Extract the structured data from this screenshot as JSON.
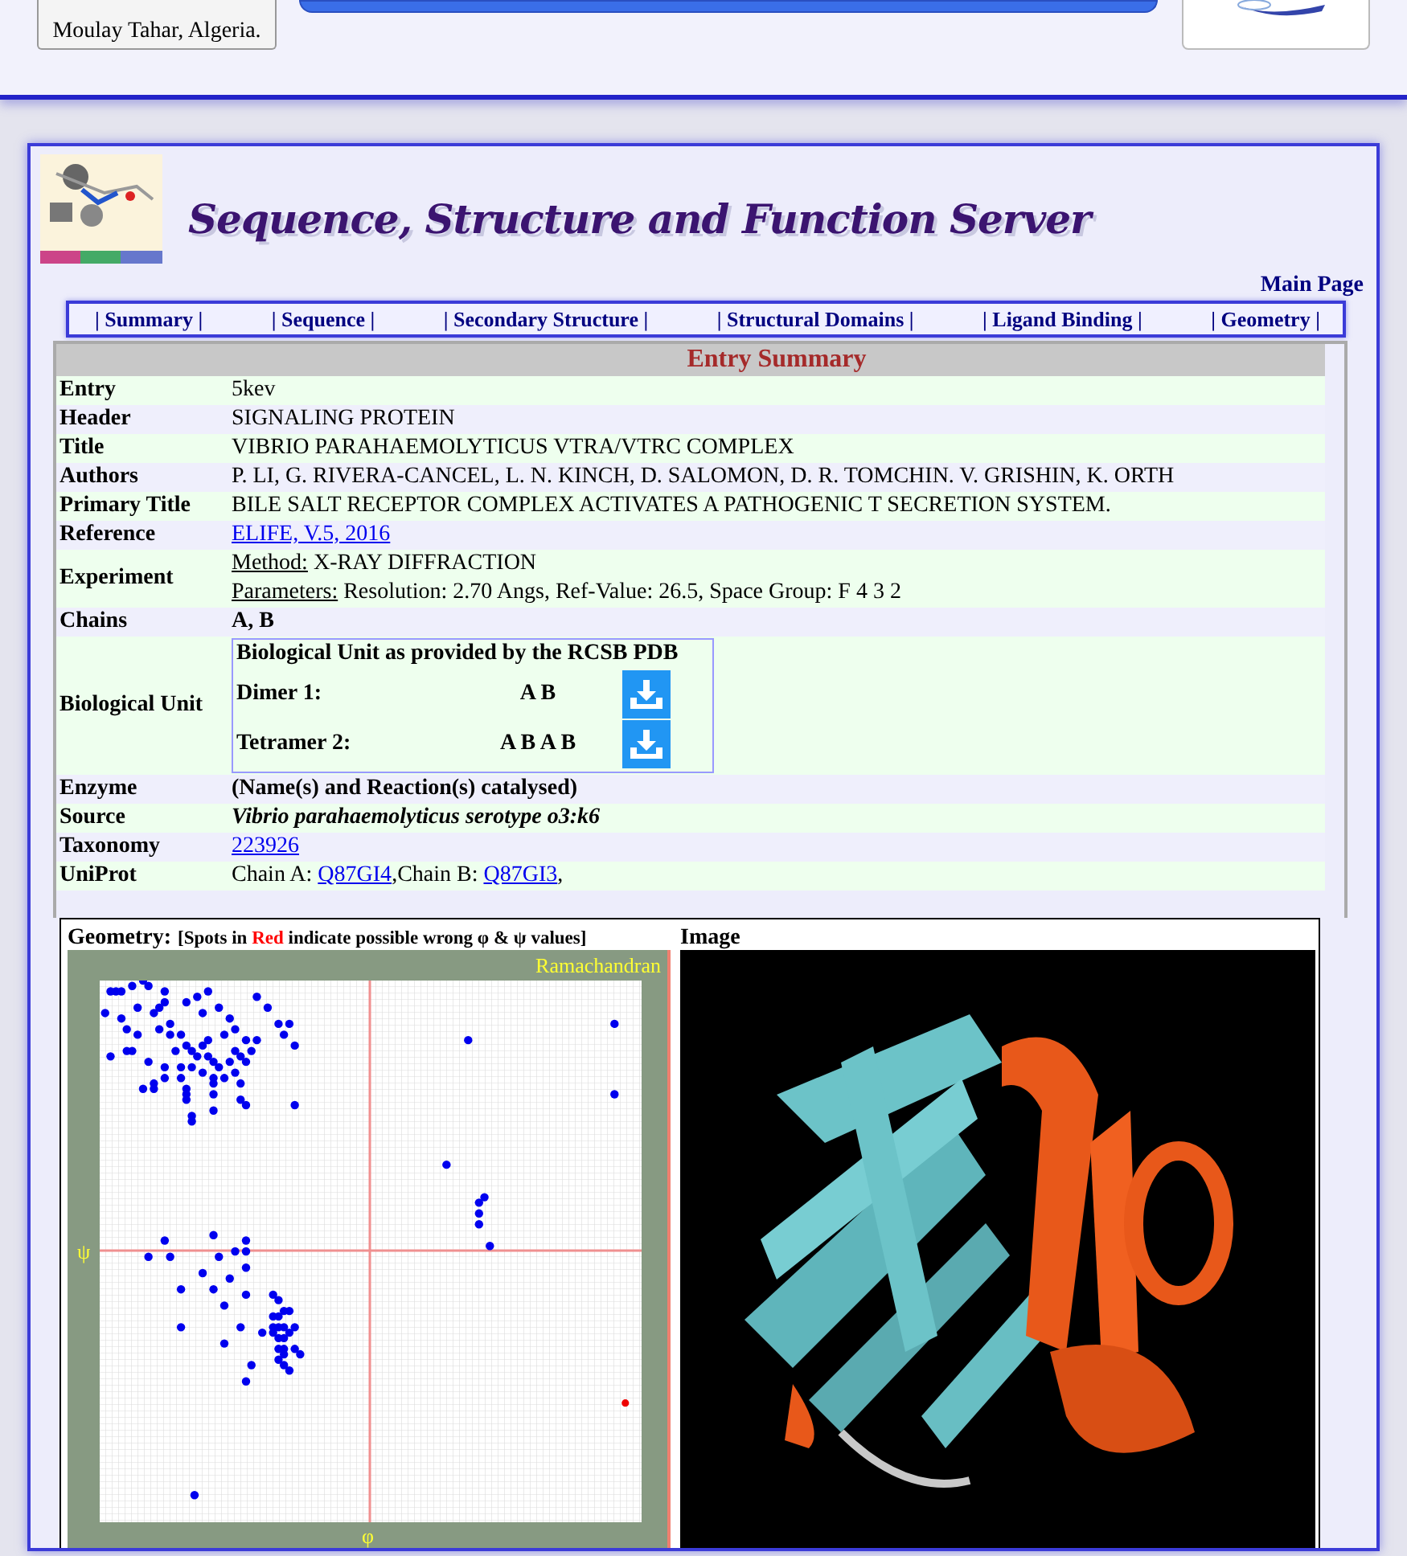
{
  "header": {
    "institution_line": "Moulay Tahar, Algeria."
  },
  "site_title": "Sequence, Structure and Function Server",
  "main_page_link": "Main Page",
  "nav": [
    {
      "label": "| Summary |"
    },
    {
      "label": "| Sequence |"
    },
    {
      "label": "| Secondary Structure |"
    },
    {
      "label": "| Structural Domains |"
    },
    {
      "label": "| Ligand Binding |"
    },
    {
      "label": "| Geometry |"
    }
  ],
  "summary": {
    "title": "Entry Summary",
    "rows": [
      {
        "label": "Entry",
        "kind": "plain",
        "lines": [
          [
            {
              "kind": "text",
              "text": "5kev"
            }
          ]
        ]
      },
      {
        "label": "Header",
        "kind": "plain",
        "lines": [
          [
            {
              "kind": "text",
              "text": "SIGNALING PROTEIN"
            }
          ]
        ]
      },
      {
        "label": "Title",
        "kind": "plain",
        "lines": [
          [
            {
              "kind": "text",
              "text": "VIBRIO PARAHAEMOLYTICUS VTRA/VTRC COMPLEX"
            }
          ]
        ]
      },
      {
        "label": "Authors",
        "kind": "plain",
        "lines": [
          [
            {
              "kind": "text",
              "text": "P. LI, G. RIVERA-CANCEL, L. N. KINCH, D. SALOMON, D. R. TOMCHIN. V. GRISHIN, K. ORTH"
            }
          ]
        ]
      },
      {
        "label": "Primary Title",
        "kind": "plain",
        "lines": [
          [
            {
              "kind": "text",
              "text": "BILE SALT RECEPTOR COMPLEX ACTIVATES A PATHOGENIC T SECRETION SYSTEM."
            }
          ]
        ]
      },
      {
        "label": "Reference",
        "kind": "plain",
        "lines": [
          [
            {
              "kind": "link",
              "text": "ELIFE, V.5, 2016"
            }
          ]
        ]
      },
      {
        "label": "Experiment",
        "kind": "plain",
        "lines": [
          [
            {
              "kind": "underlined",
              "text": "Method:"
            },
            {
              "kind": "text",
              "text": " X-RAY DIFFRACTION"
            }
          ],
          [
            {
              "kind": "underlined",
              "text": "Parameters:"
            },
            {
              "kind": "text",
              "text": " Resolution: 2.70 Angs, Ref-Value: 26.5, Space Group: F 4 3 2"
            }
          ]
        ]
      },
      {
        "label": "Chains",
        "kind": "bold",
        "lines": [
          [
            {
              "kind": "text",
              "text": "A, B"
            }
          ]
        ]
      },
      {
        "label": "Biological Unit",
        "kind": "units",
        "units": {
          "title": "Biological Unit as provided by the RCSB PDB",
          "items": [
            {
              "name": "Dimer 1:",
              "chains": "A B"
            },
            {
              "name": "Tetramer 2:",
              "chains": "A B A B"
            }
          ]
        }
      },
      {
        "label": "Enzyme",
        "kind": "bold",
        "lines": [
          [
            {
              "kind": "text",
              "text": "(Name(s) and Reaction(s) catalysed)"
            }
          ]
        ]
      },
      {
        "label": "Source",
        "kind": "bold_italic",
        "lines": [
          [
            {
              "kind": "text",
              "text": "Vibrio parahaemolyticus serotype o3:k6"
            }
          ]
        ]
      },
      {
        "label": "Taxonomy",
        "kind": "plain",
        "lines": [
          [
            {
              "kind": "link",
              "text": "223926"
            }
          ]
        ]
      },
      {
        "label": "UniProt",
        "kind": "plain",
        "lines": [
          [
            {
              "kind": "text",
              "text": "Chain A: "
            },
            {
              "kind": "link",
              "text": "Q87GI4"
            },
            {
              "kind": "text",
              "text": ",Chain B: "
            },
            {
              "kind": "link",
              "text": "Q87GI3"
            },
            {
              "kind": "text",
              "text": ","
            }
          ]
        ]
      }
    ]
  },
  "geometry": {
    "title": "Geometry:",
    "note": [
      {
        "kind": "text",
        "text": "[Spots in "
      },
      {
        "kind": "red",
        "text": "Red"
      },
      {
        "kind": "text",
        "text": " indicate possible wrong φ & ψ values]"
      }
    ],
    "plot_label": "Ramachandran",
    "psi_label": "ψ",
    "phi_label": "φ"
  },
  "image": {
    "title": "Image"
  }
}
